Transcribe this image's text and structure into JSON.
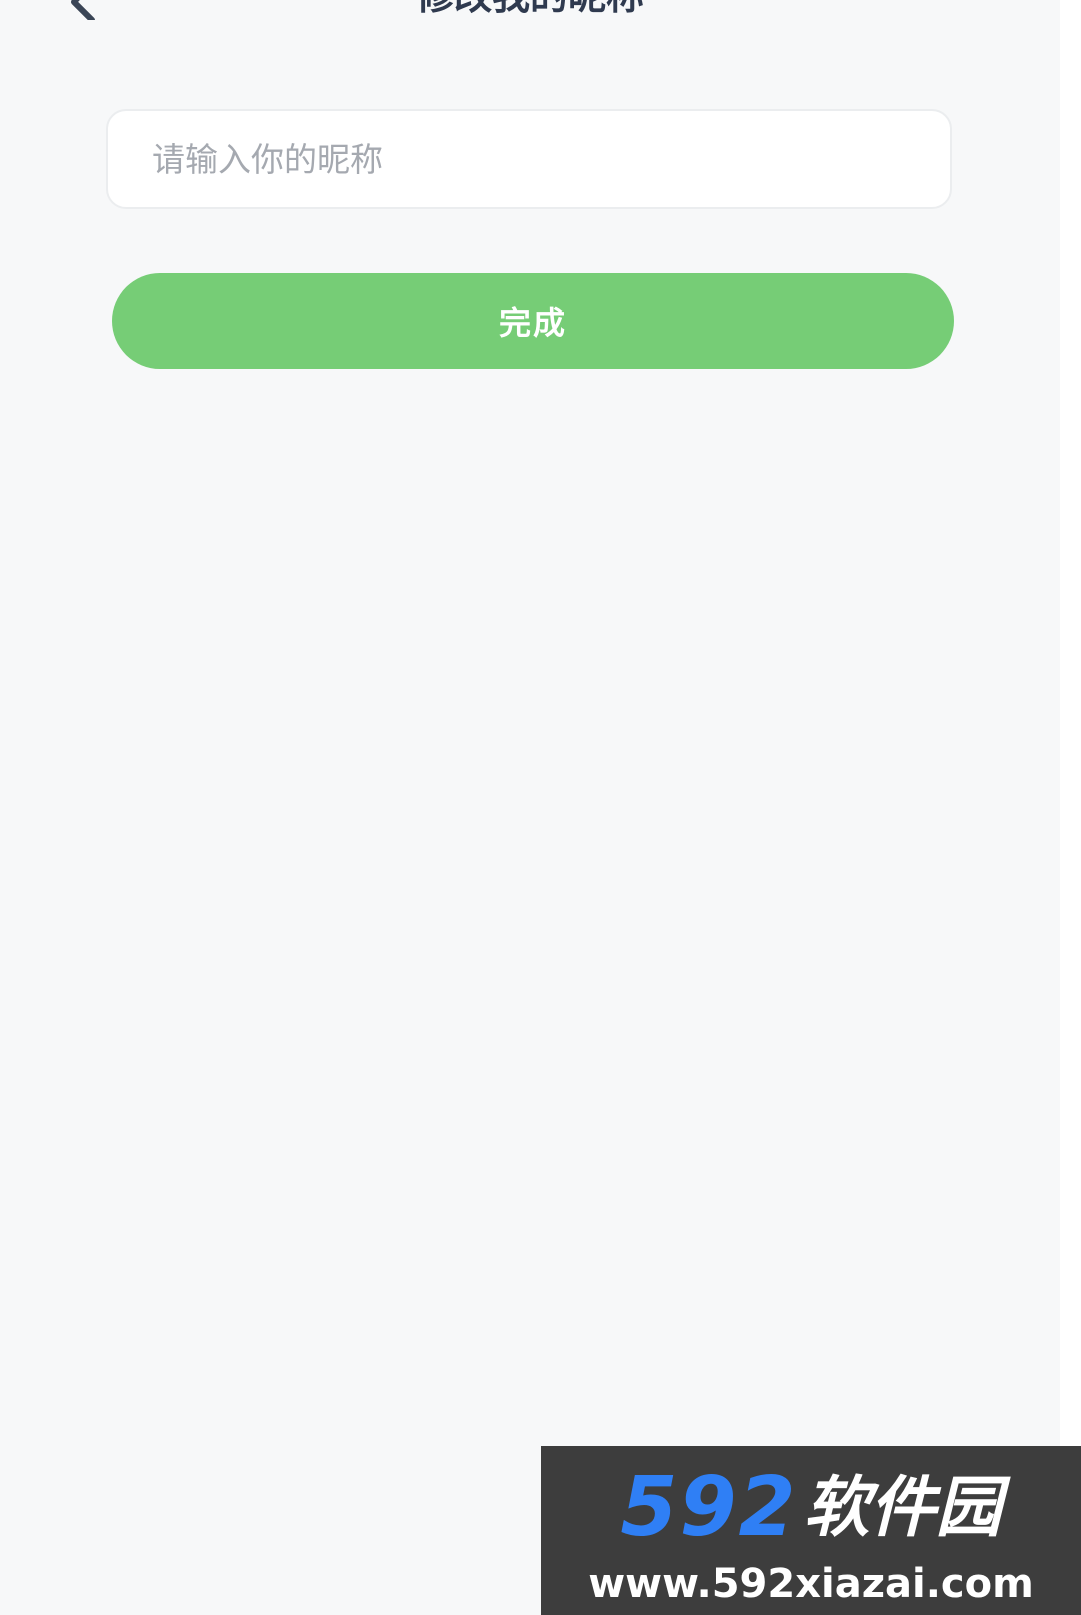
{
  "header": {
    "title": "修改我的昵称",
    "back_icon": "chevron-left-icon"
  },
  "form": {
    "nickname_placeholder": "请输入你的昵称",
    "nickname_value": "",
    "submit_label": "完成"
  },
  "watermark": {
    "digits": "592",
    "brand": "软件园",
    "url": "www.592xiazai.com"
  },
  "colors": {
    "background": "#f7f8f9",
    "button": "#76cd76",
    "title": "#2f3a4f",
    "placeholder": "#a5a9b0",
    "watermark_bg": "#3d3d3d",
    "watermark_digits": "#2f7ff5"
  }
}
